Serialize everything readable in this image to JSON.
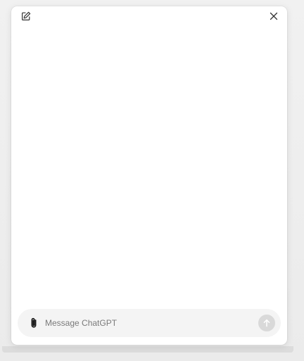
{
  "header": {
    "new_chat_icon": "compose-icon",
    "close_icon": "close-icon"
  },
  "composer": {
    "attach_icon": "paperclip-icon",
    "placeholder": "Message ChatGPT",
    "value": "",
    "send_icon": "arrow-up-icon"
  },
  "colors": {
    "panel_bg": "#ffffff",
    "composer_bg": "#f4f4f4",
    "send_button_disabled": "#d9d9d9"
  }
}
